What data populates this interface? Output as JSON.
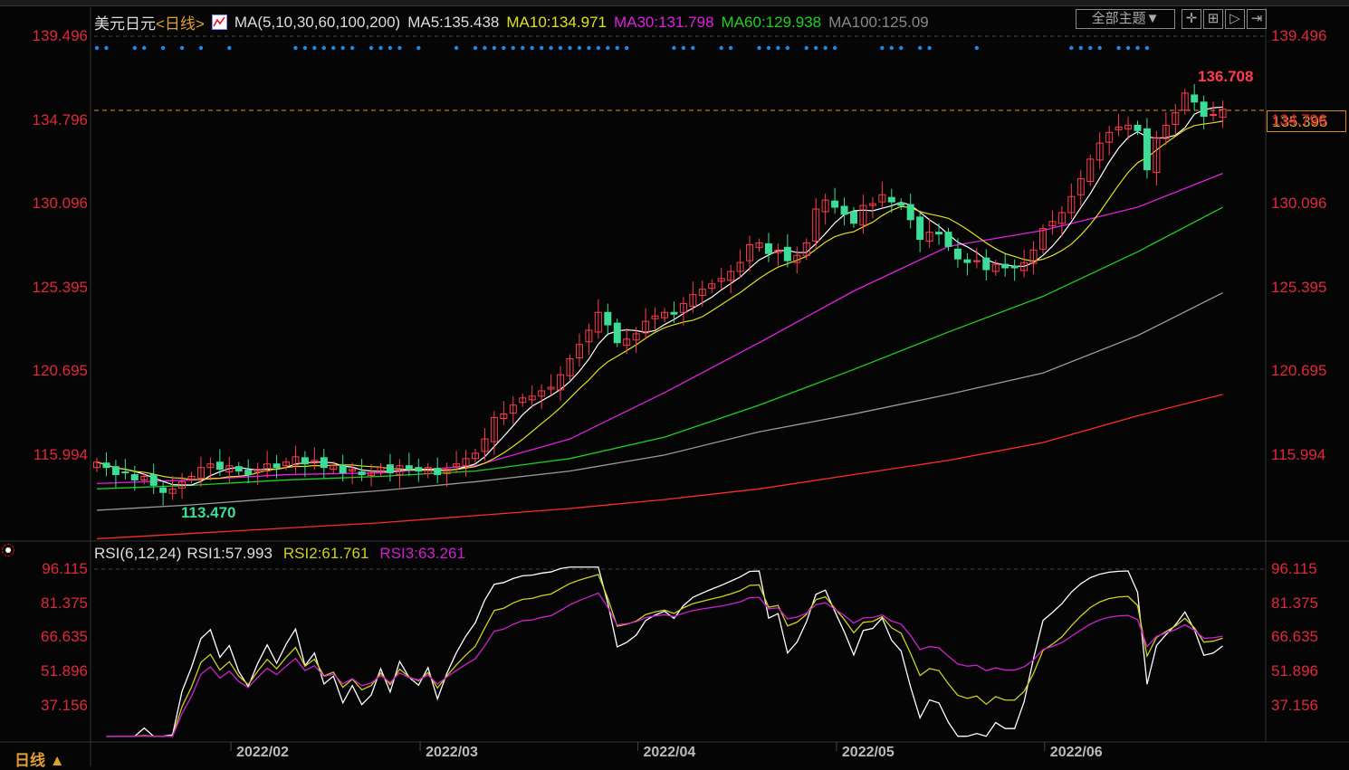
{
  "header": {
    "symbol": "美元日元",
    "period": "<日线>",
    "ma_params": "MA(5,10,30,60,100,200)",
    "ma5": "MA5:135.438",
    "ma10": "MA10:134.971",
    "ma30": "MA30:131.798",
    "ma60": "MA60:129.938",
    "ma100": "MA100:125.09",
    "theme_button": "全部主题▼"
  },
  "rsi_header": {
    "params": "RSI(6,12,24)",
    "rsi1": "RSI1:57.993",
    "rsi2": "RSI2:61.761",
    "rsi3": "RSI3:63.261"
  },
  "footer": {
    "period_button": "日线 ▲"
  },
  "colors": {
    "up": "#ff3b4e",
    "down": "#3ddc97",
    "ma5": "#ffffff",
    "ma10": "#e0e020",
    "ma30": "#e020e0",
    "ma60": "#20d020",
    "ma100": "#999999",
    "ma200": "#ff2a2a",
    "axis": "#e0283c"
  },
  "chart_data": [
    {
      "type": "candlestick",
      "title": "美元日元 日线",
      "y_ticks": [
        "139.496",
        "134.796",
        "130.096",
        "125.395",
        "120.695",
        "115.994"
      ],
      "ylim": [
        110.5,
        141.5
      ],
      "x_ticks": [
        {
          "label": "2022/02",
          "index": 18
        },
        {
          "label": "2022/03",
          "index": 38
        },
        {
          "label": "2022/04",
          "index": 61
        },
        {
          "label": "2022/05",
          "index": 82
        },
        {
          "label": "2022/06",
          "index": 104
        }
      ],
      "last_price": "135.395",
      "max_label": "136.708",
      "max_index": 115,
      "min_label": "113.470",
      "min_index": 8,
      "closes": [
        115.6,
        115.3,
        114.9,
        115.0,
        114.6,
        114.8,
        114.3,
        113.9,
        114.1,
        114.5,
        114.8,
        115.3,
        115.5,
        115.2,
        115.4,
        115.1,
        114.9,
        115.2,
        115.5,
        115.3,
        115.6,
        115.9,
        115.5,
        115.7,
        115.3,
        115.4,
        115.0,
        115.2,
        114.9,
        115.0,
        115.3,
        115.0,
        115.4,
        115.2,
        115.1,
        115.3,
        114.9,
        115.2,
        115.5,
        115.8,
        116.1,
        116.9,
        118.1,
        118.3,
        118.8,
        119.2,
        119.3,
        119.6,
        119.8,
        120.5,
        121.4,
        122.2,
        123.0,
        124.0,
        123.3,
        122.3,
        122.5,
        122.8,
        123.5,
        123.8,
        124.0,
        123.9,
        124.5,
        125.0,
        125.3,
        125.6,
        125.9,
        126.3,
        126.8,
        127.8,
        127.9,
        127.3,
        127.5,
        126.9,
        127.2,
        127.9,
        129.8,
        130.3,
        129.9,
        129.5,
        129.0,
        130.0,
        130.1,
        130.6,
        130.2,
        130.0,
        129.2,
        128.1,
        128.5,
        128.4,
        127.7,
        127.0,
        126.8,
        126.9,
        126.4,
        126.7,
        126.5,
        126.5,
        126.8,
        127.5,
        128.7,
        129.1,
        129.6,
        130.5,
        131.5,
        132.6,
        133.5,
        134.1,
        134.4,
        134.5,
        134.2,
        132.0,
        133.8,
        134.5,
        135.2,
        136.3,
        135.8,
        135.0,
        135.1,
        135.4
      ],
      "ma_sample_indices": [
        0,
        10,
        20,
        30,
        40,
        50,
        60,
        70,
        80,
        90,
        100,
        110,
        119
      ],
      "ma_series": [
        {
          "name": "MA30",
          "values": [
            114.4,
            114.6,
            114.9,
            115.0,
            115.4,
            116.9,
            119.5,
            122.3,
            125.2,
            127.7,
            128.6,
            129.9,
            131.8
          ]
        },
        {
          "name": "MA60",
          "values": [
            114.1,
            114.3,
            114.6,
            114.8,
            115.1,
            115.8,
            117.0,
            118.8,
            120.8,
            122.9,
            124.9,
            127.4,
            129.9
          ]
        },
        {
          "name": "MA100",
          "values": [
            112.9,
            113.2,
            113.6,
            114.0,
            114.5,
            115.1,
            116.0,
            117.3,
            118.3,
            119.4,
            120.6,
            122.7,
            125.1
          ]
        },
        {
          "name": "MA200",
          "values": [
            111.3,
            111.6,
            111.9,
            112.2,
            112.6,
            113.0,
            113.5,
            114.1,
            114.9,
            115.7,
            116.7,
            118.2,
            119.4
          ]
        }
      ],
      "signal_indices": [
        0,
        1,
        4,
        5,
        7,
        9,
        11,
        14,
        21,
        22,
        23,
        24,
        25,
        26,
        27,
        29,
        30,
        31,
        32,
        34,
        38,
        40,
        41,
        42,
        43,
        44,
        45,
        46,
        47,
        48,
        49,
        50,
        51,
        52,
        53,
        54,
        55,
        56,
        61,
        62,
        63,
        66,
        67,
        70,
        71,
        72,
        73,
        75,
        76,
        77,
        78,
        83,
        84,
        85,
        87,
        88,
        93,
        103,
        104,
        105,
        106,
        108,
        109,
        110,
        111
      ]
    },
    {
      "type": "line",
      "title": "RSI(6,12,24)",
      "y_ticks": [
        "96.115",
        "81.375",
        "66.635",
        "51.896",
        "37.156"
      ],
      "ylim": [
        22,
        100
      ],
      "series": [
        {
          "name": "RSI1",
          "period": 6
        },
        {
          "name": "RSI2",
          "period": 12
        },
        {
          "name": "RSI3",
          "period": 24
        }
      ]
    }
  ]
}
